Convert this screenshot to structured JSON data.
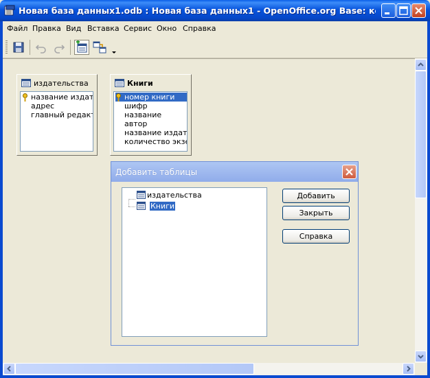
{
  "window": {
    "title": "Новая база данных1.odb : Новая база данных1 - OpenOffice.org Base: конструк…"
  },
  "menu": [
    "Файл",
    "Правка",
    "Вид",
    "Вставка",
    "Сервис",
    "Окно",
    "Справка"
  ],
  "toolbar": {
    "buttons": [
      "save-icon",
      "undo-icon",
      "redo-icon",
      "add-tables-icon",
      "add-relation-icon",
      "toolbar-options-icon"
    ]
  },
  "tables": [
    {
      "title": "издательства",
      "fields": [
        "название издател",
        "адрес",
        "главный редактор"
      ],
      "key_field_index": 0
    },
    {
      "title": "Книги",
      "fields": [
        "номер книги",
        "шифр",
        "название",
        "автор",
        "название издател",
        "количество экзем"
      ],
      "key_field_index": 0,
      "selected_field_index": 0
    }
  ],
  "dialog": {
    "title": "Добавить таблицы",
    "tree_items": [
      "издательства",
      "Книги"
    ],
    "selected_item_index": 1,
    "buttons": {
      "add": "Добавить",
      "close": "Закрыть",
      "help": "Справка"
    }
  },
  "colors": {
    "titlebar": "#0a5ee8",
    "selection": "#316ac5",
    "face": "#ece9d8"
  }
}
